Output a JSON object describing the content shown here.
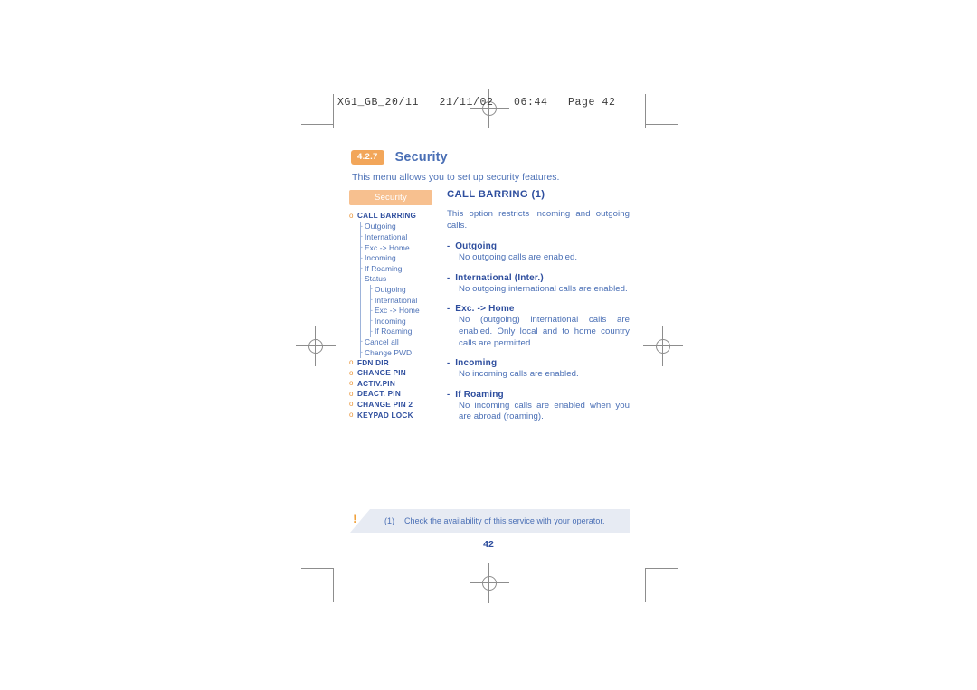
{
  "page": {
    "print_header": "XG1_GB_20/11   21/11/02   06:44   Page 42",
    "page_number": "42",
    "colors": {
      "heading_blue": "#2e4e9e",
      "body_blue": "#4a6fb5",
      "badge_orange": "#f2a65a",
      "tab_orange": "#f7c08f",
      "bullet_orange": "#e8963c",
      "footnote_bg": "#e7ebf3",
      "crop_gray": "#8d8d8d"
    }
  },
  "section": {
    "number": "4.2.7",
    "title": "Security",
    "intro": "This menu allows you to set up security features."
  },
  "sidebar": {
    "tab_label": "Security",
    "items": [
      {
        "label": "CALL BARRING",
        "level": 0,
        "marker": "o",
        "bold": true
      },
      {
        "label": "Outgoing",
        "level": 1,
        "marker": "-",
        "bold": false
      },
      {
        "label": "International",
        "level": 1,
        "marker": "-",
        "bold": false
      },
      {
        "label": "Exc -> Home",
        "level": 1,
        "marker": "-",
        "bold": false
      },
      {
        "label": "Incoming",
        "level": 1,
        "marker": "-",
        "bold": false
      },
      {
        "label": "If Roaming",
        "level": 1,
        "marker": "-",
        "bold": false
      },
      {
        "label": "Status",
        "level": 1,
        "marker": "-",
        "bold": false
      },
      {
        "label": "Outgoing",
        "level": 2,
        "marker": "-",
        "bold": false
      },
      {
        "label": "International",
        "level": 2,
        "marker": "-",
        "bold": false
      },
      {
        "label": "Exc -> Home",
        "level": 2,
        "marker": "-",
        "bold": false
      },
      {
        "label": "Incoming",
        "level": 2,
        "marker": "-",
        "bold": false
      },
      {
        "label": "If Roaming",
        "level": 2,
        "marker": "-",
        "bold": false
      },
      {
        "label": "Cancel all",
        "level": 1,
        "marker": "-",
        "bold": false
      },
      {
        "label": "Change PWD",
        "level": 1,
        "marker": "-",
        "bold": false
      },
      {
        "label": "FDN DIR",
        "level": 0,
        "marker": "o",
        "bold": true
      },
      {
        "label": "CHANGE PIN",
        "level": 0,
        "marker": "o",
        "bold": true
      },
      {
        "label": "ACTIV.PIN",
        "level": 0,
        "marker": "o",
        "bold": true
      },
      {
        "label": "DEACT. PIN",
        "level": 0,
        "marker": "o",
        "bold": true
      },
      {
        "label": "CHANGE PIN 2",
        "level": 0,
        "marker": "o",
        "bold": true
      },
      {
        "label": "KEYPAD LOCK",
        "level": 0,
        "marker": "o",
        "bold": true
      }
    ]
  },
  "main": {
    "heading": "CALL BARRING (1)",
    "intro": "This option restricts incoming and outgoing calls.",
    "entries": [
      {
        "dash": "-",
        "term": "Outgoing",
        "text": "No outgoing calls are enabled."
      },
      {
        "dash": "-",
        "term": "International (Inter.)",
        "text": "No outgoing international calls are enabled."
      },
      {
        "dash": "-",
        "term": "Exc. -> Home",
        "text": "No (outgoing) international calls are enabled. Only local and to home country calls are permitted."
      },
      {
        "dash": "-",
        "term": "Incoming",
        "text": "No incoming calls are enabled."
      },
      {
        "dash": "-",
        "term": "If Roaming",
        "text": "No incoming calls are enabled when you are abroad (roaming)."
      }
    ]
  },
  "footnote": {
    "icon": "!",
    "marker": "(1)",
    "text": "Check the availability of this service with your operator."
  }
}
